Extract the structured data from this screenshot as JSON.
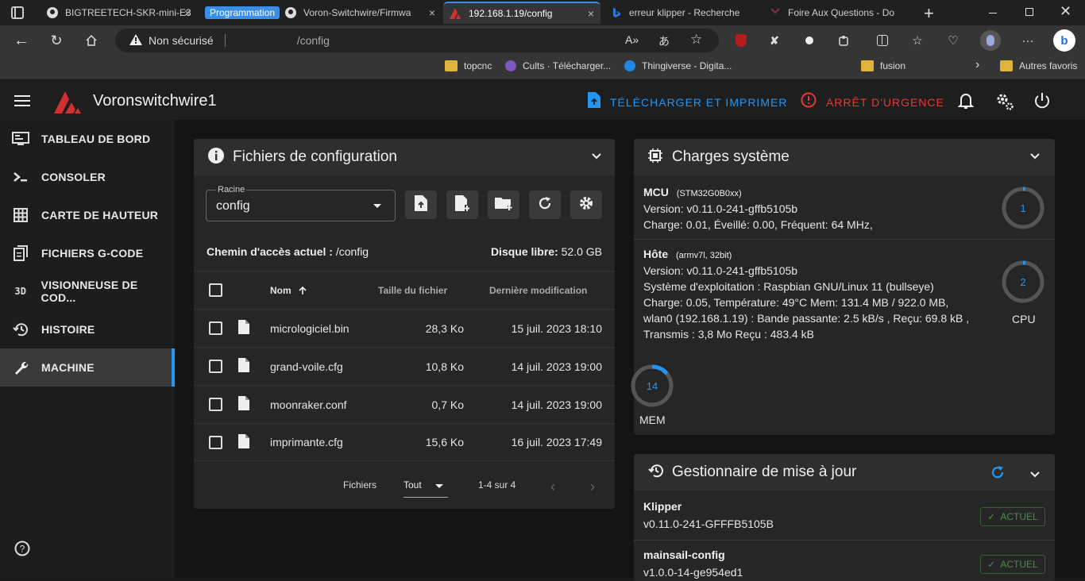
{
  "browser": {
    "tabs": [
      {
        "title": "BIGTREETECH-SKR-mini-E3",
        "icon": "github-icon"
      },
      {
        "group_label": "Programmation",
        "title": "Voron-Switchwire/Firmwa",
        "icon": "github-icon"
      },
      {
        "title": "192.168.1.19/config",
        "icon": "mainsail-icon",
        "active": true
      },
      {
        "title": "erreur klipper - Recherche",
        "icon": "bing-icon"
      },
      {
        "title": "Foire Aux Questions - Do",
        "icon": "page-icon"
      }
    ],
    "address": {
      "security_label": "Non sécurisé",
      "path": "/config"
    },
    "favorites": [
      "topcnc",
      "Cults · Télécharger...",
      "Thingiverse - Digita...",
      "fusion",
      "Autres favoris"
    ]
  },
  "app": {
    "title": "Voronswitchwire1",
    "upload_print_label": "TÉLÉCHARGER ET IMPRIMER",
    "emergency_label": "ARRÊT D'URGENCE",
    "accent": "#2196f3",
    "danger": "#e53935"
  },
  "sidebar": {
    "items": [
      {
        "label": "TABLEAU DE BORD",
        "icon": "dashboard-icon"
      },
      {
        "label": "CONSOLER",
        "icon": "console-icon"
      },
      {
        "label": "CARTE DE HAUTEUR",
        "icon": "grid-icon"
      },
      {
        "label": "FICHIERS G-CODE",
        "icon": "files-icon"
      },
      {
        "label": "VISIONNEUSE DE COD...",
        "icon": "3d-icon",
        "icon_text": "3D"
      },
      {
        "label": "HISTOIRE",
        "icon": "history-icon"
      },
      {
        "label": "MACHINE",
        "icon": "wrench-icon",
        "selected": true
      }
    ]
  },
  "config_files": {
    "title": "Fichiers de configuration",
    "root_label": "Racine",
    "root_value": "config",
    "current_path_label": "Chemin d'accès actuel :",
    "current_path": "/config",
    "free_disk_label": "Disque libre:",
    "free_disk": "52.0 GB",
    "columns": {
      "name": "Nom",
      "size": "Taille du fichier",
      "modified": "Dernière modification"
    },
    "files": [
      {
        "name": "micrologiciel.bin",
        "size": "28,3 Ko",
        "modified": "15 juil. 2023 18:10"
      },
      {
        "name": "grand-voile.cfg",
        "size": "10,8 Ko",
        "modified": "14 juil. 2023 19:00"
      },
      {
        "name": "moonraker.conf",
        "size": "0,7 Ko",
        "modified": "14 juil. 2023 19:00"
      },
      {
        "name": "imprimante.cfg",
        "size": "15,6 Ko",
        "modified": "16 juil. 2023 17:49"
      }
    ],
    "footer": {
      "files_label": "Fichiers",
      "per_page": "Tout",
      "range": "1-4 sur 4"
    }
  },
  "system_load": {
    "title": "Charges système",
    "mcu": {
      "name": "MCU",
      "chip": "(STM32G0B0xx)",
      "version": "Version: v0.11.0-241-gffb5105b",
      "load": "Charge: 0.01, Éveillé: 0.00, Fréquent: 64 MHz,",
      "gauge_value": "1",
      "gauge_fraction": 0.01
    },
    "host": {
      "name": "Hôte",
      "arch": "(armv7l, 32bit)",
      "version": "Version: v0.11.0-241-gffb5105b",
      "os": "Système d'exploitation : Raspbian GNU/Linux 11 (bullseye)",
      "load": "Charge: 0.05, Température: 49°C Mem: 131.4 MB / 922.0 MB,",
      "network": "wlan0 (192.168.1.19) : Bande passante: 2.5 kB/s , Reçu: 69.8 kB ,",
      "transmit": "Transmis : 3,8 Mo Reçu : 483.4 kB",
      "cpu_value": "2",
      "cpu_fraction": 0.02,
      "cpu_label": "CPU",
      "mem_value": "14",
      "mem_fraction": 0.14,
      "mem_label": "MEM"
    }
  },
  "update_manager": {
    "title": "Gestionnaire de mise à jour",
    "items": [
      {
        "name": "Klipper",
        "version": "v0.11.0-241-GFFFB5105B",
        "status": "ACTUEL"
      },
      {
        "name": "mainsail-config",
        "version": "v1.0.0-14-ge954ed1",
        "status": "ACTUEL"
      }
    ]
  }
}
